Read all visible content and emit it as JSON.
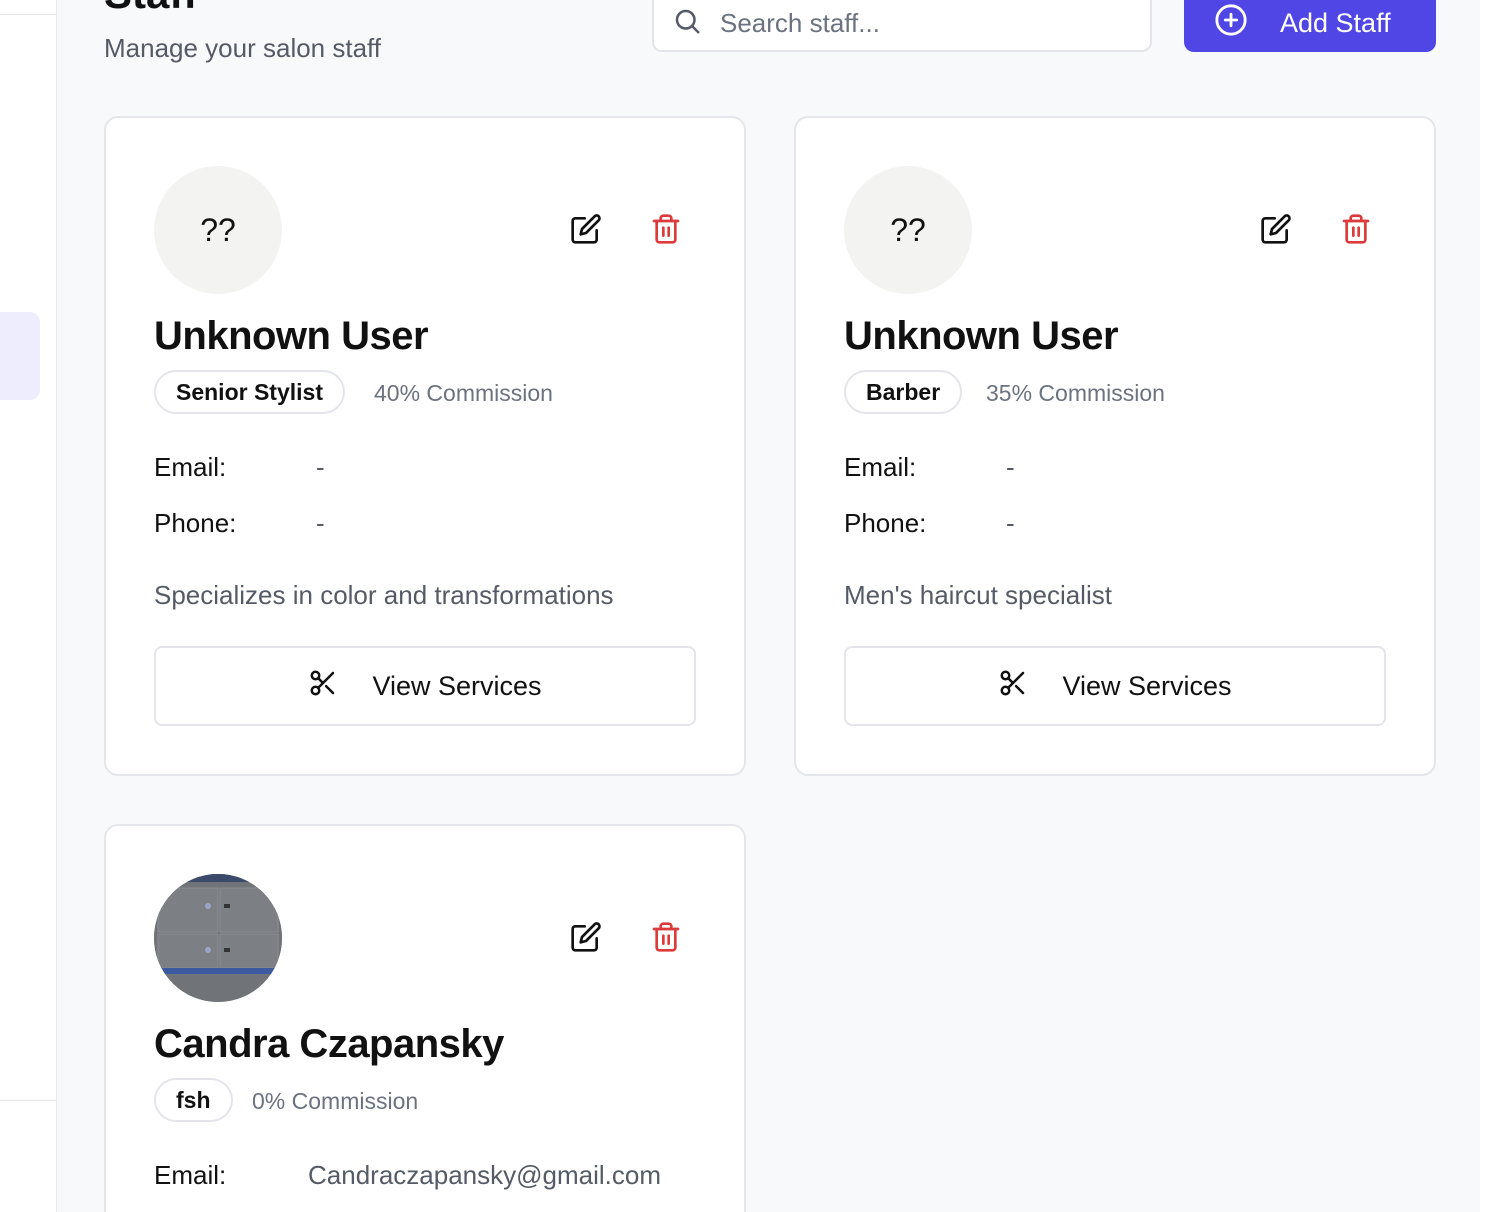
{
  "header": {
    "title": "Staff",
    "subtitle": "Manage your salon staff",
    "search_placeholder": "Search staff...",
    "add_button_label": "Add Staff"
  },
  "colors": {
    "accent": "#4f46e5",
    "danger": "#dc3b3b",
    "background": "#f8f9fb"
  },
  "labels": {
    "email": "Email:",
    "phone": "Phone:",
    "view_services": "View Services"
  },
  "staff": [
    {
      "initials": "??",
      "name": "Unknown User",
      "role": "Senior Stylist",
      "commission": "40% Commission",
      "email": "-",
      "phone": "-",
      "description": "Specializes in color and transformations"
    },
    {
      "initials": "??",
      "name": "Unknown User",
      "role": "Barber",
      "commission": "35% Commission",
      "email": "-",
      "phone": "-",
      "description": "Men's haircut specialist"
    },
    {
      "avatar": "photo",
      "name": "Candra Czapansky",
      "role": "fsh",
      "commission": "0% Commission",
      "email": "Candraczapansky@gmail.com"
    }
  ]
}
